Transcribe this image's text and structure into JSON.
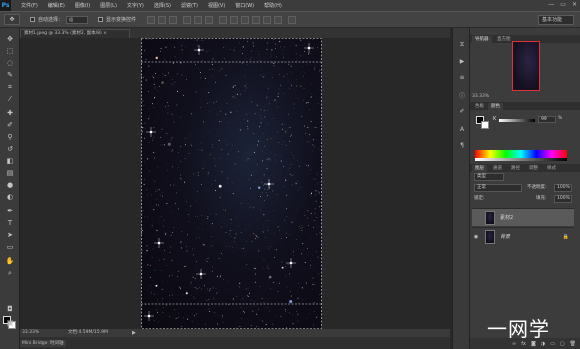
{
  "app": {
    "logo": "Ps"
  },
  "menu": [
    "文件(F)",
    "编辑(E)",
    "图像(I)",
    "图层(L)",
    "文字(Y)",
    "选择(S)",
    "滤镜(T)",
    "视图(V)",
    "窗口(W)",
    "帮助(H)"
  ],
  "window_controls": [
    "—",
    "▭",
    "✕"
  ],
  "options": {
    "auto_select_label": "自动选择：",
    "auto_select_value": "组",
    "show_transform_label": "显示变换控件",
    "workspace": "基本功能"
  },
  "tabs": [
    {
      "label": "素材1.jpeg @ 33.3% (素材2, 副本/8) ×",
      "active": true
    }
  ],
  "status": {
    "zoom": "33.33%",
    "doc_info": "文档:4.59M/15.9M"
  },
  "bottom_tabs": [
    "Mini Bridge",
    "时间轴"
  ],
  "navigator": {
    "tabs": [
      "导航器",
      "直方图"
    ],
    "zoom": "33.33%"
  },
  "color_panel": {
    "tabs": [
      "色板",
      "颜色"
    ],
    "channel_label": "K",
    "value": "99",
    "unit": "%"
  },
  "layers_panel": {
    "tabs": [
      "图层",
      "通道",
      "路径",
      "调整",
      "样式"
    ],
    "filter_label": "类型",
    "blend_mode": "正常",
    "opacity_label": "不透明度:",
    "opacity_value": "100%",
    "lock_label": "锁定:",
    "fill_label": "填充:",
    "fill_value": "100%",
    "layers": [
      {
        "name": "素材2",
        "selected": true,
        "locked": false
      },
      {
        "name": "背景",
        "selected": false,
        "locked": true
      }
    ]
  },
  "watermark": "一网学",
  "colors": {
    "accent_red": "#e0303a",
    "ps_blue": "#2fa3f5",
    "ui_dark": "#282828"
  }
}
